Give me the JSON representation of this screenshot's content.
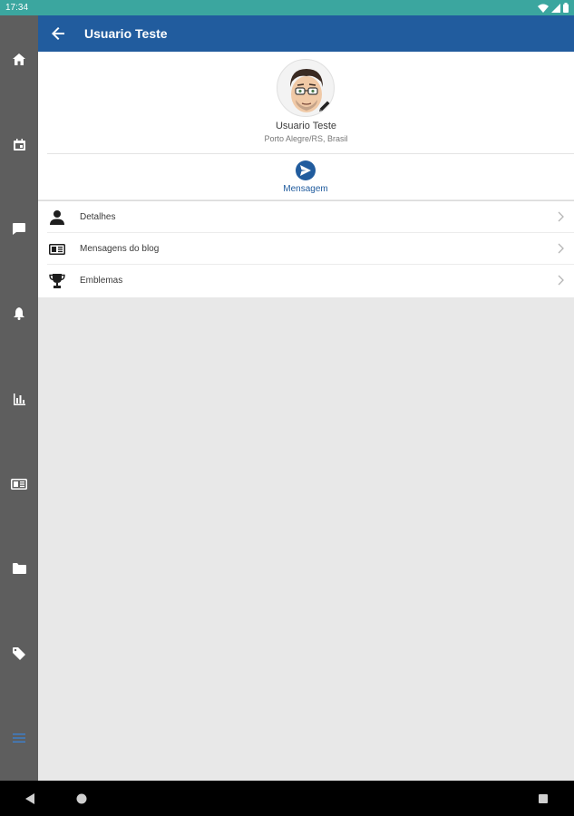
{
  "status_bar": {
    "time": "17:34",
    "icons": [
      "wifi-icon",
      "signal-icon",
      "battery-icon"
    ],
    "background": "#3ba69f"
  },
  "nav_rail": {
    "background": "#5e5e5e",
    "items": [
      {
        "icon": "home-icon"
      },
      {
        "icon": "calendar-icon"
      },
      {
        "icon": "chat-icon"
      },
      {
        "icon": "bell-icon"
      },
      {
        "icon": "bar-chart-icon"
      },
      {
        "icon": "newspaper-icon"
      },
      {
        "icon": "folder-icon"
      },
      {
        "icon": "tag-icon"
      },
      {
        "icon": "menu-icon"
      }
    ]
  },
  "app_bar": {
    "title": "Usuario Teste",
    "background": "#215c9e"
  },
  "profile": {
    "name": "Usuario Teste",
    "location": "Porto Alegre/RS, Brasil",
    "action_label": "Mensagem"
  },
  "menu": [
    {
      "label": "Detalhes",
      "icon": "person-icon"
    },
    {
      "label": "Mensagens do blog",
      "icon": "newspaper-icon"
    },
    {
      "label": "Emblemas",
      "icon": "trophy-icon"
    }
  ],
  "system_nav": {
    "icons": [
      "back-triangle-icon",
      "home-circle-icon",
      "recents-square-icon"
    ]
  }
}
